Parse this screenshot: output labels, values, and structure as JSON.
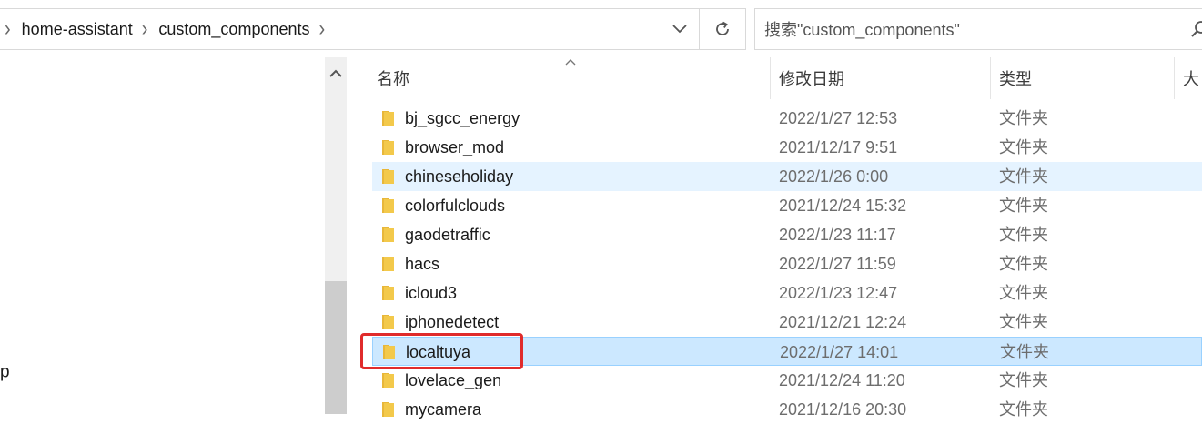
{
  "breadcrumb": {
    "items": [
      "home-assistant",
      "custom_components"
    ]
  },
  "search": {
    "placeholder": "搜索\"custom_components\""
  },
  "navpane": {
    "partial_label": "p"
  },
  "columns": {
    "name": "名称",
    "date": "修改日期",
    "type": "类型",
    "size": "大"
  },
  "files": [
    {
      "name": "bj_sgcc_energy",
      "date": "2022/1/27 12:53",
      "type": "文件夹",
      "state": "normal"
    },
    {
      "name": "browser_mod",
      "date": "2021/12/17 9:51",
      "type": "文件夹",
      "state": "normal"
    },
    {
      "name": "chineseholiday",
      "date": "2022/1/26 0:00",
      "type": "文件夹",
      "state": "hover"
    },
    {
      "name": "colorfulclouds",
      "date": "2021/12/24 15:32",
      "type": "文件夹",
      "state": "normal"
    },
    {
      "name": "gaodetraffic",
      "date": "2022/1/23 11:17",
      "type": "文件夹",
      "state": "normal"
    },
    {
      "name": "hacs",
      "date": "2022/1/27 11:59",
      "type": "文件夹",
      "state": "normal"
    },
    {
      "name": "icloud3",
      "date": "2022/1/23 12:47",
      "type": "文件夹",
      "state": "normal"
    },
    {
      "name": "iphonedetect",
      "date": "2021/12/21 12:24",
      "type": "文件夹",
      "state": "normal"
    },
    {
      "name": "localtuya",
      "date": "2022/1/27 14:01",
      "type": "文件夹",
      "state": "selected"
    },
    {
      "name": "lovelace_gen",
      "date": "2021/12/24 11:20",
      "type": "文件夹",
      "state": "normal"
    },
    {
      "name": "mycamera",
      "date": "2021/12/16 20:30",
      "type": "文件夹",
      "state": "normal"
    }
  ],
  "colors": {
    "hover_row": "#e5f3ff",
    "selected_row": "#cce8ff",
    "annotation": "#e02b2b",
    "folder": "#f3c94b"
  },
  "icons": {
    "breadcrumb_separator": "chevron-right-icon",
    "address_dropdown": "chevron-down-icon",
    "refresh": "refresh-icon",
    "search": "search-icon",
    "folder": "folder-icon",
    "sort": "sort-ascending-icon",
    "scroll_up": "scroll-up-arrow-icon"
  }
}
